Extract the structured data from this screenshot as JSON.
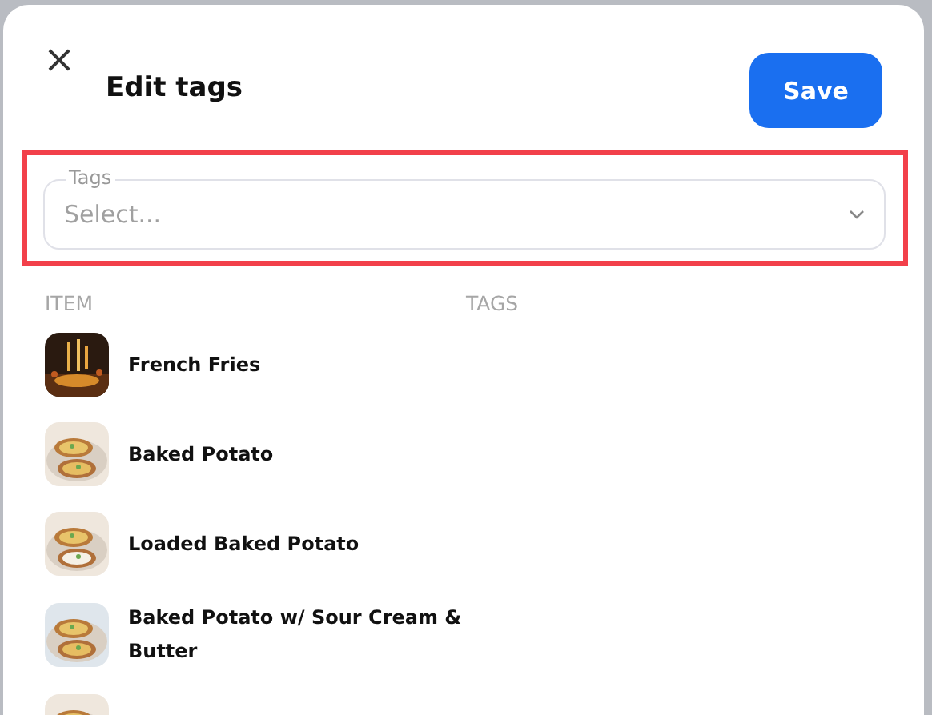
{
  "dialog": {
    "title": "Edit tags",
    "close_icon": "×",
    "save_button": "Save"
  },
  "tags_field": {
    "label": "Tags",
    "placeholder": "Select...",
    "highlighted": true
  },
  "columns": [
    "ITEM",
    "TAGS"
  ],
  "items": [
    {
      "name": "French Fries",
      "kind": "picture"
    },
    {
      "name": "Baked Potato",
      "kind": "picture"
    },
    {
      "name": "Loaded Baked Potato",
      "kind": "picture"
    },
    {
      "name": "Baked Potato w/ Sour Cream & Butter",
      "kind": "picture"
    },
    {
      "kind": "picture"
    }
  ]
}
